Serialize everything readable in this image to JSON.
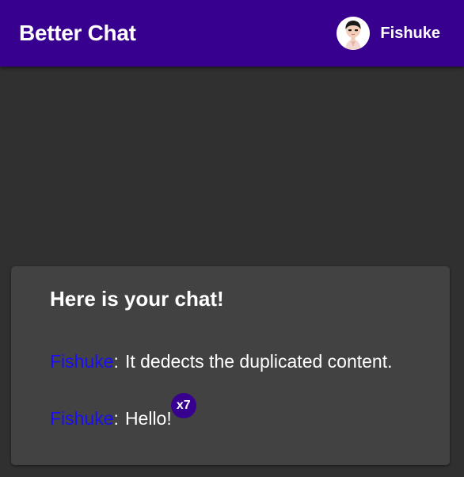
{
  "app": {
    "title": "Better Chat"
  },
  "user": {
    "name": "Fishuke",
    "avatar_icon": "user-avatar-icon"
  },
  "chat": {
    "heading": "Here is your chat!",
    "separator": ":",
    "messages": [
      {
        "author": "Fishuke",
        "text": "It dedects the duplicated content.",
        "duplicate_count": ""
      },
      {
        "author": "Fishuke",
        "text": "Hello!",
        "duplicate_count": "x7"
      }
    ]
  },
  "colors": {
    "primary": "#37008f",
    "background": "#303030",
    "card": "#424242",
    "author_link": "#1a0ef5",
    "text": "#ffffff"
  }
}
